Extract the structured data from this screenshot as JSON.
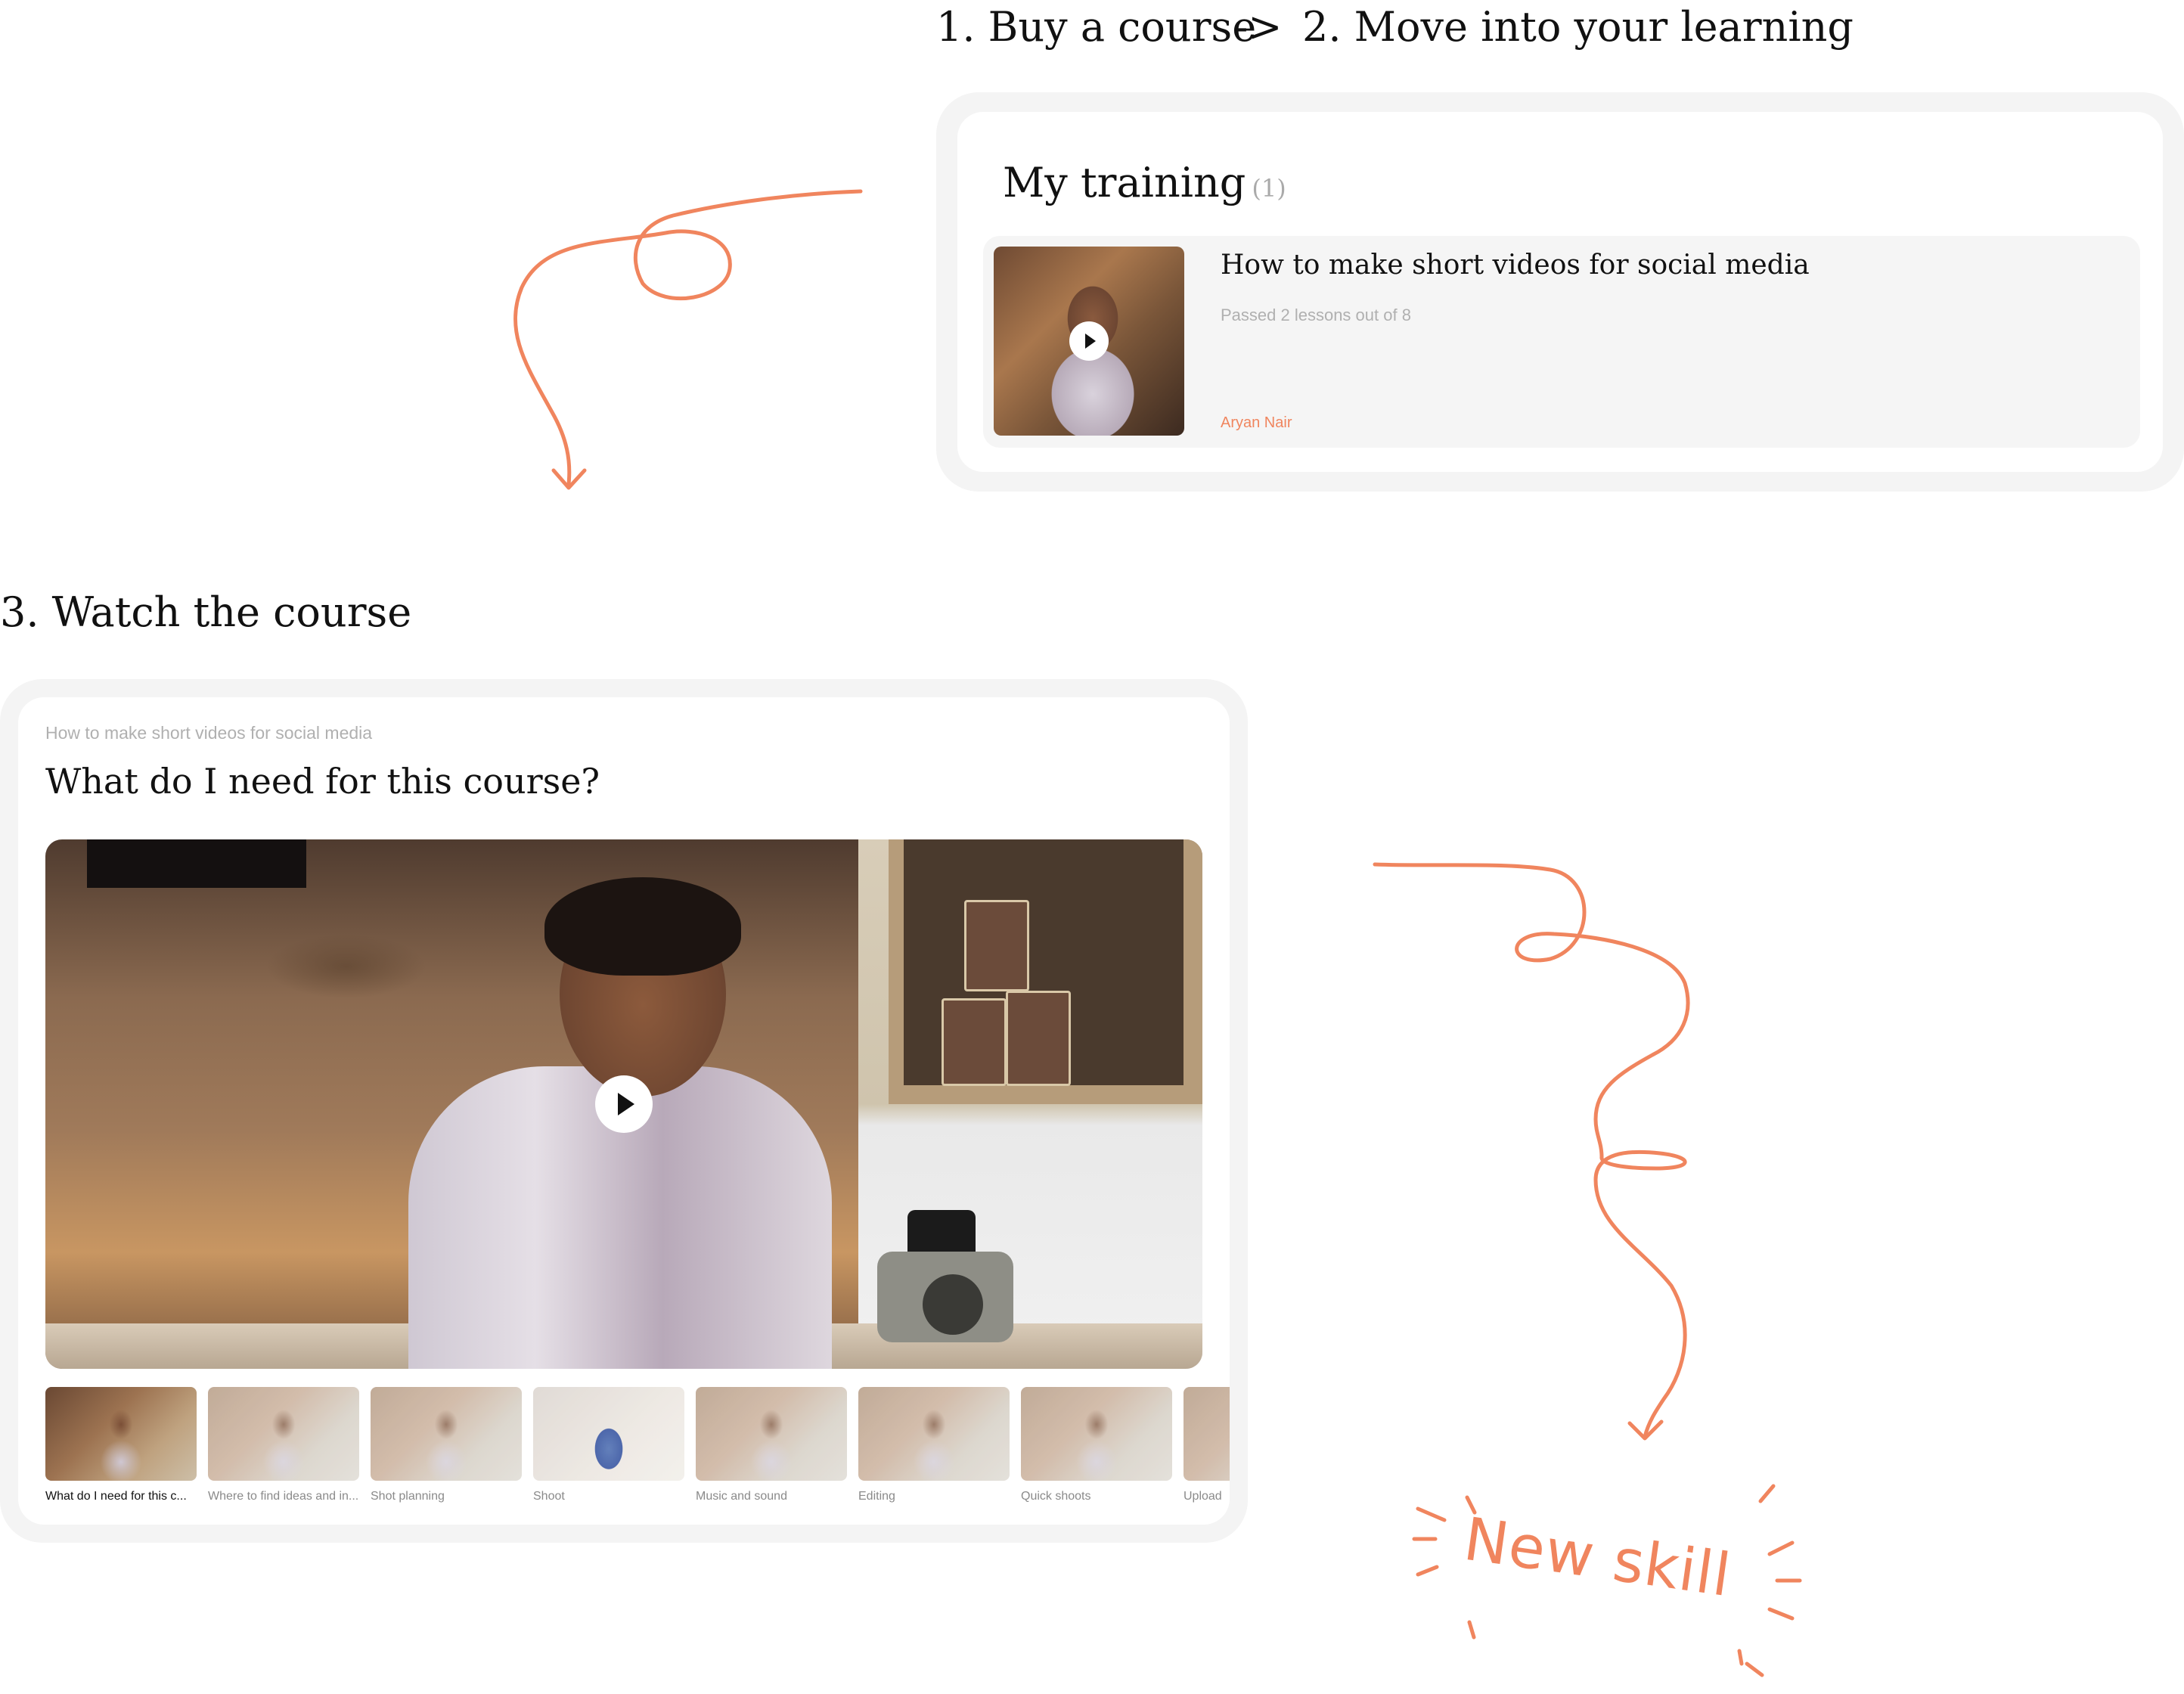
{
  "steps": {
    "step1": "1. Buy a course",
    "arrow": "->",
    "step2": "2. Move into your learning",
    "step3": "3. Watch the course"
  },
  "training": {
    "heading": "My training",
    "count": "(1)",
    "course": {
      "title": "How to make short videos for social media",
      "progress": "Passed 2 lessons out of 8",
      "author": "Aryan Nair"
    }
  },
  "player": {
    "breadcrumb": "How to make short videos for social media",
    "lesson_title": "What do I need for this course?",
    "lessons": [
      {
        "label": "What do I need for this c...",
        "active": true
      },
      {
        "label": "Where to find ideas and in...",
        "active": false
      },
      {
        "label": "Shot planning",
        "active": false
      },
      {
        "label": "Shoot",
        "active": false
      },
      {
        "label": "Music and sound",
        "active": false
      },
      {
        "label": "Editing",
        "active": false
      },
      {
        "label": "Quick shoots",
        "active": false
      },
      {
        "label": "Upload",
        "active": false
      }
    ]
  },
  "annotation": {
    "text": "New skill"
  },
  "colors": {
    "accent": "#f0855e",
    "card_outer": "#f4f4f4",
    "row_bg": "#f5f5f5",
    "muted_text": "#b0b0b0"
  },
  "icons": [
    "play-icon",
    "arrow-doodle",
    "sparkle-lines"
  ]
}
